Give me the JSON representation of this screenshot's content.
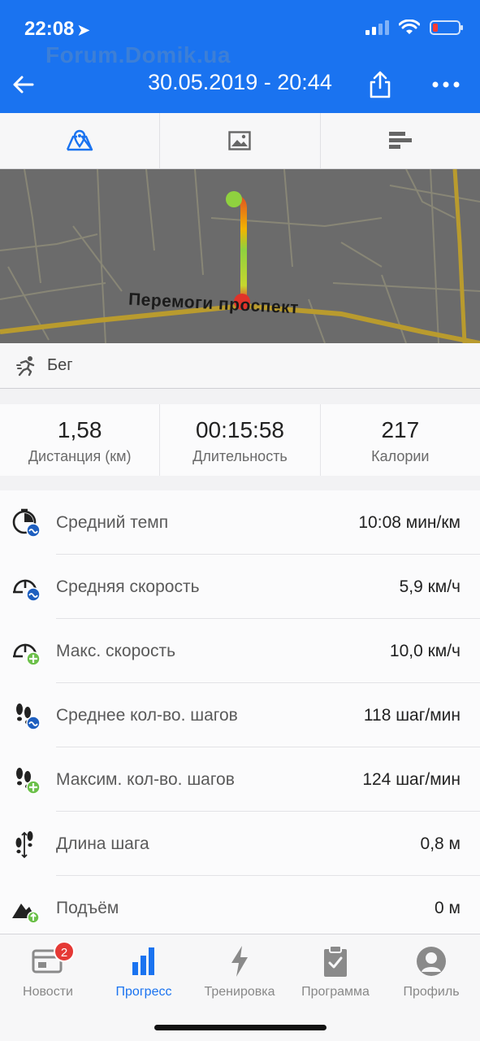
{
  "status_bar": {
    "time": "22:08"
  },
  "watermark": "Forum.Domik.ua",
  "header": {
    "title": "30.05.2019 - 20:44"
  },
  "tabs": [
    {
      "icon": "map-icon",
      "active": true
    },
    {
      "icon": "image-icon",
      "active": false
    },
    {
      "icon": "chart-bars-icon",
      "active": false
    }
  ],
  "map": {
    "street_label": "Перемоги проспект"
  },
  "activity": {
    "type": "Бег",
    "icon": "running-icon"
  },
  "summary": [
    {
      "value": "1,58",
      "label": "Дистанция (км)"
    },
    {
      "value": "00:15:58",
      "label": "Длительность"
    },
    {
      "value": "217",
      "label": "Калории"
    }
  ],
  "stats": [
    {
      "icon": "pace-avg-icon",
      "name": "Средний темп",
      "value": "10:08 мин/км"
    },
    {
      "icon": "speed-avg-icon",
      "name": "Средняя скорость",
      "value": "5,9 км/ч"
    },
    {
      "icon": "speed-max-icon",
      "name": "Макс. скорость",
      "value": "10,0 км/ч"
    },
    {
      "icon": "steps-avg-icon",
      "name": "Среднее кол-во. шагов",
      "value": "118 шаг/мин"
    },
    {
      "icon": "steps-max-icon",
      "name": "Максим. кол-во. шагов",
      "value": "124 шаг/мин"
    },
    {
      "icon": "stride-length-icon",
      "name": "Длина шага",
      "value": "0,8 м"
    },
    {
      "icon": "elevation-icon",
      "name": "Подъём",
      "value": "0 м"
    }
  ],
  "bottom_nav": [
    {
      "label": "Новости",
      "icon": "news-icon",
      "badge": "2",
      "active": false
    },
    {
      "label": "Прогресс",
      "icon": "progress-icon",
      "active": true
    },
    {
      "label": "Тренировка",
      "icon": "workout-icon",
      "active": false
    },
    {
      "label": "Программа",
      "icon": "program-icon",
      "active": false
    },
    {
      "label": "Профиль",
      "icon": "profile-icon",
      "active": false
    }
  ],
  "colors": {
    "accent": "#1a73f0",
    "badge": "#e53935",
    "route_start": "#8fd13f",
    "route_end": "#e53935"
  }
}
